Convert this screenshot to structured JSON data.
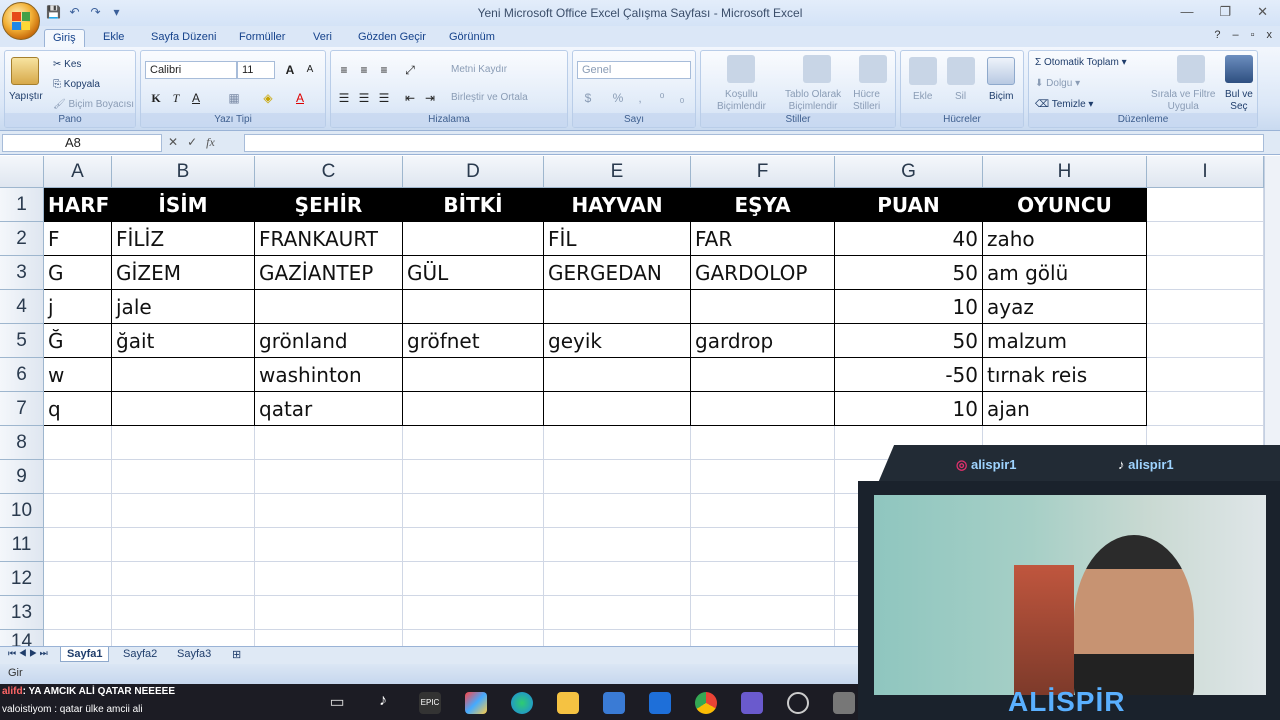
{
  "window": {
    "title": "Yeni Microsoft Office Excel Çalışma Sayfası - Microsoft Excel"
  },
  "tabs": [
    "Giriş",
    "Ekle",
    "Sayfa Düzeni",
    "Formüller",
    "Veri",
    "Gözden Geçir",
    "Görünüm"
  ],
  "ribbon": {
    "pano": {
      "label": "Pano",
      "paste": "Yapıştır",
      "cut": "Kes",
      "copy": "Kopyala",
      "format_painter": "Biçim Boyacısı"
    },
    "font": {
      "label": "Yazı Tipi",
      "font_name": "Calibri",
      "font_size": "11"
    },
    "align": {
      "label": "Hizalama",
      "wrap": "Metni Kaydır",
      "merge": "Birleştir ve Ortala"
    },
    "number": {
      "label": "Sayı",
      "format": "Genel"
    },
    "styles": {
      "label": "Stiller",
      "cond1": "Koşullu",
      "cond2": "Biçimlendir",
      "table1": "Tablo Olarak",
      "table2": "Biçimlendir",
      "cell1": "Hücre",
      "cell2": "Stilleri"
    },
    "cells": {
      "label": "Hücreler",
      "insert": "Ekle",
      "delete": "Sil",
      "format": "Biçim"
    },
    "edit": {
      "label": "Düzenleme",
      "autosum": "Otomatik Toplam",
      "fill": "Dolgu",
      "clear": "Temizle",
      "sort1": "Sırala ve Filtre",
      "sort2": "Uygula",
      "find1": "Bul ve",
      "find2": "Seç"
    }
  },
  "namebox": "A8",
  "columns": [
    "A",
    "B",
    "C",
    "D",
    "E",
    "F",
    "G",
    "H",
    "I"
  ],
  "rows": [
    "1",
    "2",
    "3",
    "4",
    "5",
    "6",
    "7",
    "8",
    "9",
    "10",
    "11",
    "12",
    "13",
    "14"
  ],
  "table": {
    "headers": [
      "HARF",
      "İSİM",
      "ŞEHİR",
      "BİTKİ",
      "HAYVAN",
      "EŞYA",
      "PUAN",
      "OYUNCU"
    ],
    "rows": [
      [
        "F",
        "FİLİZ",
        "FRANKAURT",
        "",
        "FİL",
        "FAR",
        "40",
        "zaho"
      ],
      [
        "G",
        "GİZEM",
        "GAZİANTEP",
        "GÜL",
        "GERGEDAN",
        "GARDOLOP",
        "50",
        "am gölü"
      ],
      [
        "j",
        "jale",
        "",
        "",
        "",
        "",
        "10",
        "ayaz"
      ],
      [
        "Ğ",
        "ğait",
        "grönland",
        "gröfnet",
        "geyik",
        "gardrop",
        "50",
        "malzum"
      ],
      [
        "w",
        "",
        "washinton",
        "",
        "",
        "",
        "-50",
        "tırnak reis"
      ],
      [
        "q",
        "",
        "qatar",
        "",
        "",
        "",
        "10",
        "ajan"
      ]
    ]
  },
  "sheets": [
    "Sayfa1",
    "Sayfa2",
    "Sayfa3"
  ],
  "status": "Gir",
  "chat": {
    "line1": ": YA AMCIK ALİ QATAR NEEEEE",
    "line2": "valoistiyom : qatar ülke amcii ali"
  },
  "overlay": {
    "instagram": "alispir1",
    "tiktok": "alispir1",
    "name": "ALİSPİR"
  }
}
